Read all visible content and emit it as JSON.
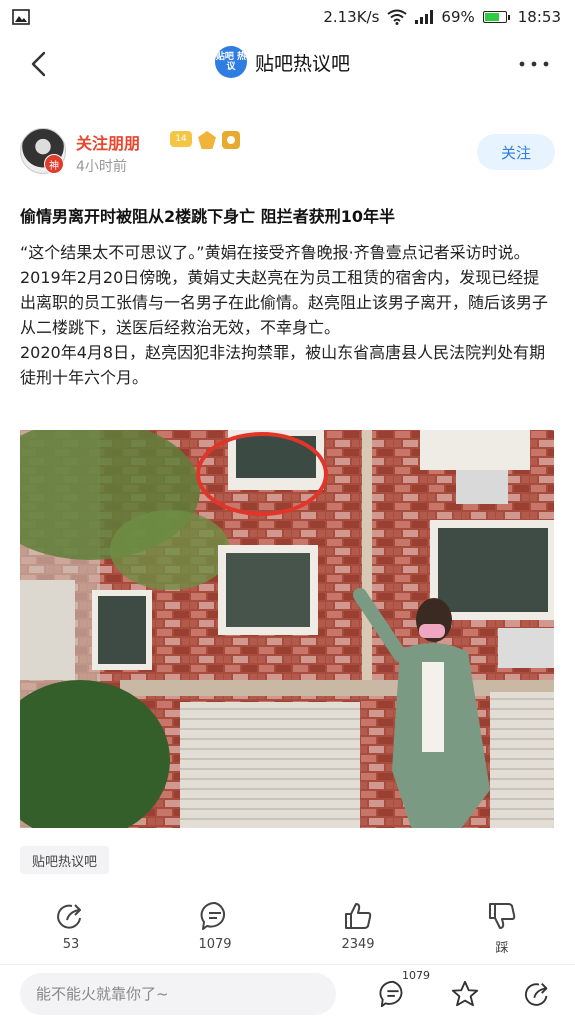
{
  "status_bar": {
    "speed": "2.13K/s",
    "battery": "69%",
    "battery_level": 0.69,
    "time": "18:53"
  },
  "nav": {
    "logo_text": "贴吧 热议",
    "title": "贴吧热议吧"
  },
  "author": {
    "name": "关注朋朋",
    "avatar_badge": "神",
    "level_badge": "14",
    "time": "4小时前",
    "follow_label": "关注"
  },
  "post": {
    "title": "偷情男离开时被阻从2楼跳下身亡 阻拦者获刑10年半",
    "paragraph1": "“这个结果太不可思议了。”黄娟在接受齐鲁晚报·齐鲁壹点记者采访时说。2019年2月20日傍晚，黄娟丈夫赵亮在为员工租赁的宿舍内，发现已经提出离职的员工张倩与一名男子在此偷情。赵亮阻止该男子离开，随后该男子从二楼跳下，送医后经救治无效，不幸身亡。",
    "paragraph2": "2020年4月8日，赵亮因犯非法拘禁罪，被山东省高唐县人民法院判处有期徒刑十年六个月。",
    "tag": "贴吧热议吧"
  },
  "actions": {
    "share": "53",
    "comment": "1079",
    "like": "2349",
    "dislike": "踩"
  },
  "bottom": {
    "placeholder": "能不能火就靠你了~",
    "comment_count": "1079"
  },
  "colors": {
    "accent": "#2f7de1",
    "author_name": "#e8472e",
    "follow_bg": "#e7f3ff"
  }
}
